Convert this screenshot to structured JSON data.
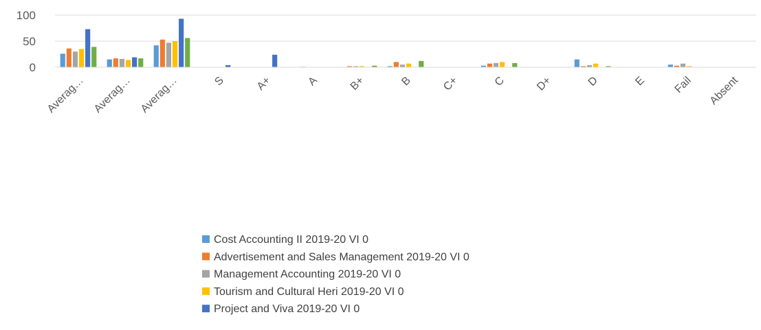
{
  "chart_data": {
    "type": "bar",
    "title": "",
    "xlabel": "",
    "ylabel": "",
    "ylim": [
      0,
      100
    ],
    "yticks": [
      0,
      50,
      100
    ],
    "grid": true,
    "legend_position": "bottom",
    "categories": [
      "Averag…",
      "Averag…",
      "Averag…",
      "S",
      "A+",
      "A",
      "B+",
      "B",
      "C+",
      "C",
      "D+",
      "D",
      "E",
      "Fail",
      "Absent"
    ],
    "series": [
      {
        "name": "Cost Accounting II 2019-20 VI 0",
        "color": "#5B9BD5",
        "values": [
          26,
          15,
          42,
          0,
          0,
          0,
          0,
          2,
          0,
          3,
          0,
          15,
          0,
          5,
          0
        ]
      },
      {
        "name": "Advertisement and Sales Management 2019-20 VI 0",
        "color": "#ED7D31",
        "values": [
          36,
          17,
          53,
          0,
          0,
          1,
          2,
          10,
          0,
          7,
          0,
          2,
          0,
          3,
          0
        ]
      },
      {
        "name": "Management Accounting 2019-20 VI 0",
        "color": "#A5A5A5",
        "values": [
          30,
          16,
          47,
          0,
          0,
          0,
          2,
          5,
          0,
          8,
          0,
          4,
          0,
          7,
          0
        ]
      },
      {
        "name": "Tourism and Cultural Heri 2019-20 VI 0",
        "color": "#FFC000",
        "values": [
          35,
          14,
          50,
          0,
          0,
          0,
          2,
          7,
          0,
          10,
          0,
          7,
          0,
          2,
          0
        ]
      },
      {
        "name": "Project and Viva 2019-20 VI 0",
        "color": "#4472C4",
        "values": [
          73,
          19,
          93,
          4,
          24,
          0,
          0,
          0,
          0,
          0,
          0,
          0,
          0,
          0,
          0
        ]
      },
      {
        "name": "",
        "color": "#70AD47",
        "values": [
          39,
          17,
          56,
          0,
          0,
          0,
          3,
          12,
          0,
          8,
          0,
          2,
          0,
          0,
          0
        ]
      }
    ],
    "legend": [
      {
        "label": "Cost Accounting II 2019-20 VI 0",
        "color": "#5B9BD5"
      },
      {
        "label": "Advertisement and Sales Management 2019-20 VI 0",
        "color": "#ED7D31"
      },
      {
        "label": "Management Accounting 2019-20 VI 0",
        "color": "#A5A5A5"
      },
      {
        "label": "Tourism and Cultural Heri 2019-20 VI 0",
        "color": "#FFC000"
      },
      {
        "label": "Project and Viva 2019-20 VI 0",
        "color": "#4472C4"
      }
    ]
  }
}
